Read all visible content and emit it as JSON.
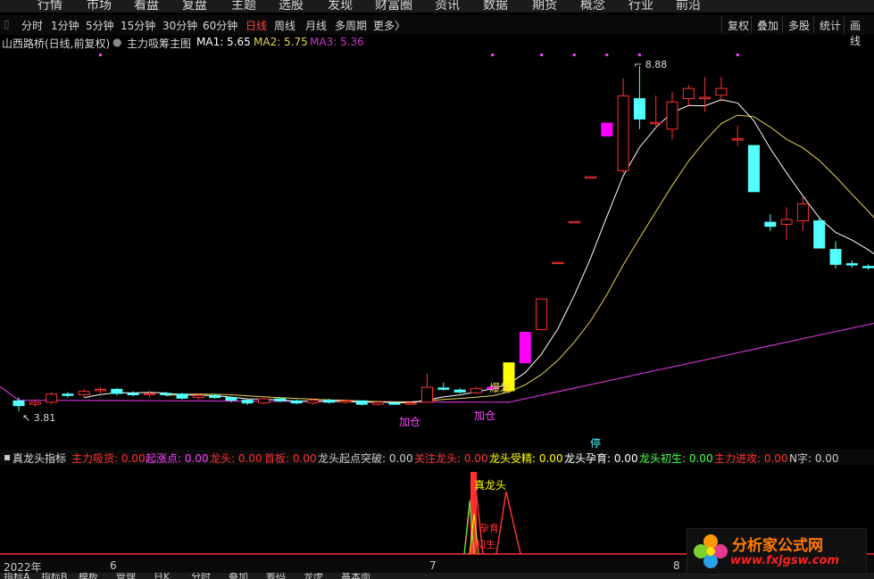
{
  "top_nav": [
    "行情",
    "市场",
    "看盘",
    "复盘",
    "主题",
    "选股",
    "发现",
    "财富圈",
    "资讯",
    "数据",
    "期货",
    "概念",
    "行业",
    "前沿"
  ],
  "periods": [
    "分时",
    "1分钟",
    "5分钟",
    "15分钟",
    "30分钟",
    "60分钟",
    "日线",
    "周线",
    "月线",
    "多周期",
    "更多〉"
  ],
  "active_period": "日线",
  "right_buttons": [
    "复权",
    "叠加",
    "多股",
    "统计",
    "画线"
  ],
  "info": {
    "stock": "山西路桥(日线,前复权)",
    "indicator": "主力吸筹主图",
    "ma1": "MA1: 5.65",
    "ma2": "MA2: 5.75",
    "ma3": "MA3: 5.36",
    "colors": {
      "ma1": "#ffffff",
      "ma2": "#e8d44d",
      "ma3": "#cc33cc"
    }
  },
  "main_chart": {
    "price_high_label": "8.88",
    "price_low_label": "3.81",
    "annotations": [
      "爆发",
      "加仓",
      "加仓",
      "停"
    ],
    "candles": [
      {
        "o": 3.95,
        "c": 3.88,
        "h": 4.0,
        "l": 3.8
      },
      {
        "o": 3.9,
        "c": 3.93,
        "h": 3.97,
        "l": 3.86
      },
      {
        "o": 3.93,
        "c": 4.05,
        "h": 4.08,
        "l": 3.9
      },
      {
        "o": 4.05,
        "c": 4.03,
        "h": 4.08,
        "l": 4.0
      },
      {
        "o": 4.04,
        "c": 4.09,
        "h": 4.12,
        "l": 4.0
      },
      {
        "o": 4.1,
        "c": 4.12,
        "h": 4.15,
        "l": 4.06
      },
      {
        "o": 4.12,
        "c": 4.06,
        "h": 4.14,
        "l": 4.03
      },
      {
        "o": 4.06,
        "c": 4.04,
        "h": 4.09,
        "l": 4.02
      },
      {
        "o": 4.04,
        "c": 4.06,
        "h": 4.1,
        "l": 4.0
      },
      {
        "o": 4.06,
        "c": 4.05,
        "h": 4.08,
        "l": 4.02
      },
      {
        "o": 4.05,
        "c": 3.99,
        "h": 4.07,
        "l": 3.97
      },
      {
        "o": 4.0,
        "c": 4.03,
        "h": 4.06,
        "l": 3.97
      },
      {
        "o": 4.03,
        "c": 4.0,
        "h": 4.05,
        "l": 3.98
      },
      {
        "o": 4.0,
        "c": 3.96,
        "h": 4.01,
        "l": 3.93
      },
      {
        "o": 3.96,
        "c": 3.92,
        "h": 3.97,
        "l": 3.89
      },
      {
        "o": 3.92,
        "c": 3.98,
        "h": 4.01,
        "l": 3.9
      },
      {
        "o": 3.98,
        "c": 3.95,
        "h": 4.0,
        "l": 3.93
      },
      {
        "o": 3.95,
        "c": 3.92,
        "h": 3.97,
        "l": 3.9
      },
      {
        "o": 3.92,
        "c": 3.96,
        "h": 3.99,
        "l": 3.89
      },
      {
        "o": 3.96,
        "c": 3.93,
        "h": 3.98,
        "l": 3.91
      },
      {
        "o": 3.93,
        "c": 3.95,
        "h": 3.97,
        "l": 3.91
      },
      {
        "o": 3.95,
        "c": 3.9,
        "h": 3.96,
        "l": 3.88
      },
      {
        "o": 3.9,
        "c": 3.93,
        "h": 3.95,
        "l": 3.88
      },
      {
        "o": 3.92,
        "c": 3.91,
        "h": 3.94,
        "l": 3.89
      },
      {
        "o": 3.91,
        "c": 3.92,
        "h": 3.94,
        "l": 3.9
      },
      {
        "o": 3.93,
        "c": 4.15,
        "h": 4.35,
        "l": 3.92
      },
      {
        "o": 4.14,
        "c": 4.13,
        "h": 4.22,
        "l": 4.1
      },
      {
        "o": 4.11,
        "c": 4.08,
        "h": 4.14,
        "l": 4.06
      },
      {
        "o": 4.07,
        "c": 4.13,
        "h": 4.16,
        "l": 4.05
      },
      {
        "o": 4.13,
        "c": 4.15,
        "h": 4.18,
        "l": 4.1
      },
      {
        "o": 4.1,
        "c": 4.51,
        "h": 4.51,
        "l": 4.1
      },
      {
        "o": 4.51,
        "c": 4.96,
        "h": 4.96,
        "l": 4.51
      },
      {
        "o": 5.0,
        "c": 5.45,
        "h": 5.45,
        "l": 5.0
      },
      {
        "o": 5.99,
        "c": 5.99,
        "h": 5.99,
        "l": 5.99
      },
      {
        "o": 6.59,
        "c": 6.59,
        "h": 6.59,
        "l": 6.59
      },
      {
        "o": 7.25,
        "c": 7.25,
        "h": 7.25,
        "l": 7.25
      },
      {
        "o": 7.85,
        "c": 8.04,
        "h": 8.04,
        "l": 7.85
      },
      {
        "o": 7.34,
        "c": 8.44,
        "h": 8.7,
        "l": 7.3
      },
      {
        "o": 8.4,
        "c": 8.1,
        "h": 8.88,
        "l": 7.95
      },
      {
        "o": 8.05,
        "c": 8.05,
        "h": 8.45,
        "l": 7.95
      },
      {
        "o": 7.95,
        "c": 8.35,
        "h": 8.5,
        "l": 7.8
      },
      {
        "o": 8.4,
        "c": 8.55,
        "h": 8.6,
        "l": 8.3
      },
      {
        "o": 8.4,
        "c": 8.42,
        "h": 8.72,
        "l": 8.2
      },
      {
        "o": 8.45,
        "c": 8.55,
        "h": 8.72,
        "l": 8.35
      },
      {
        "o": 7.81,
        "c": 7.81,
        "h": 8.0,
        "l": 7.7
      },
      {
        "o": 7.71,
        "c": 7.03,
        "h": 7.71,
        "l": 7.03
      },
      {
        "o": 6.58,
        "c": 6.52,
        "h": 6.7,
        "l": 6.45
      },
      {
        "o": 6.55,
        "c": 6.62,
        "h": 6.8,
        "l": 6.32
      },
      {
        "o": 6.6,
        "c": 6.85,
        "h": 6.95,
        "l": 6.45
      },
      {
        "o": 6.6,
        "c": 6.2,
        "h": 6.65,
        "l": 6.2
      },
      {
        "o": 6.18,
        "c": 5.96,
        "h": 6.3,
        "l": 5.9
      },
      {
        "o": 5.97,
        "c": 5.96,
        "h": 6.02,
        "l": 5.91
      },
      {
        "o": 5.93,
        "c": 5.91,
        "h": 5.96,
        "l": 5.88
      },
      {
        "o": 5.9,
        "c": 5.96,
        "h": 6.0,
        "l": 5.88
      },
      {
        "o": 5.98,
        "c": 6.03,
        "h": 6.07,
        "l": 5.94
      },
      {
        "o": 6.0,
        "c": 6.05,
        "h": 6.25,
        "l": 5.98
      },
      {
        "o": 6.1,
        "c": 6.2,
        "h": 6.38,
        "l": 6.0
      }
    ]
  },
  "indicator_panel": {
    "name": "真龙头指标",
    "items": [
      {
        "text": "主力吸货: 0.00",
        "color": "#ff3030"
      },
      {
        "text": "起涨点: 0.00",
        "color": "#ff40ff"
      },
      {
        "text": "龙头: 0.00",
        "color": "#ff3030"
      },
      {
        "text": "首板: 0.00",
        "color": "#ff3030"
      },
      {
        "text": "龙头起点突破: 0.00",
        "color": "#cccccc"
      },
      {
        "text": "关注龙头: 0.00",
        "color": "#ff3030"
      },
      {
        "text": "龙头受精: 0.00",
        "color": "#ffff00"
      },
      {
        "text": "龙头孕育: 0.00",
        "color": "#ffffff"
      },
      {
        "text": "龙头初生: 0.00",
        "color": "#40ff40"
      },
      {
        "text": "主力进攻: 0.00",
        "color": "#ff3030"
      },
      {
        "text": "N字: 0.00",
        "color": "#cccccc"
      }
    ],
    "labels": [
      "真龙头",
      "孕育",
      "初生"
    ]
  },
  "date_axis": [
    "2022年",
    "6",
    "7",
    "8"
  ],
  "bottom_tabs": [
    "指标A",
    "指标B",
    "模板",
    "管理",
    "日K",
    "分时",
    "叠加",
    "筹码",
    "龙虎",
    "基本面"
  ],
  "logo": {
    "title": "分析家公式网",
    "url": "www.fxjgsw.com"
  }
}
